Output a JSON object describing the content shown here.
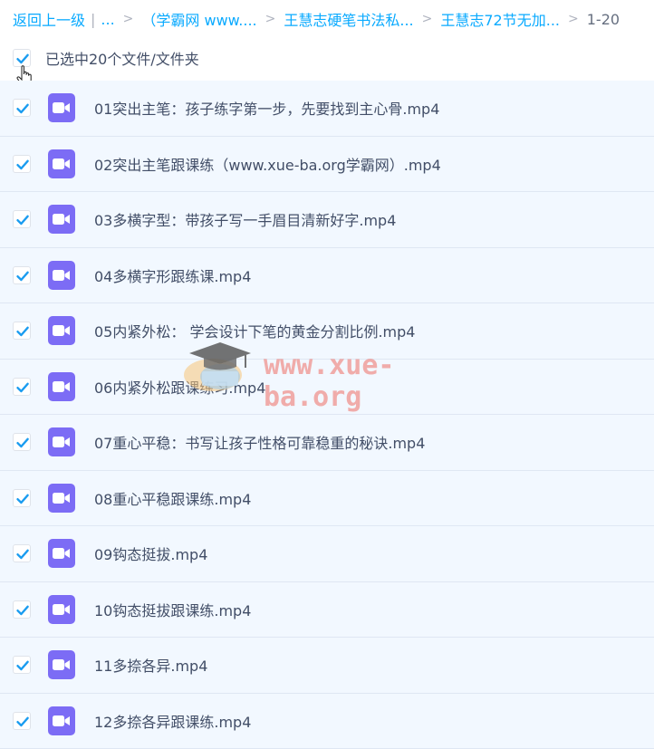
{
  "breadcrumb": {
    "back": "返回上一级",
    "sep_bar": "|",
    "ellipsis": "...",
    "chevron": ">",
    "crumb1": "（学霸网 www....",
    "crumb2": "王慧志硬笔书法私...",
    "crumb3": "王慧志72节无加...",
    "current": "1-20"
  },
  "selection": {
    "label": "已选中20个文件/文件夹",
    "checked": true
  },
  "files": [
    {
      "name": "01突出主笔：孩子练字第一步，先要找到主心骨.mp4",
      "checked": true
    },
    {
      "name": "02突出主笔跟课练（www.xue-ba.org学霸网）.mp4",
      "checked": true
    },
    {
      "name": "03多横字型：带孩子写一手眉目清新好字.mp4",
      "checked": true
    },
    {
      "name": "04多横字形跟练课.mp4",
      "checked": true
    },
    {
      "name": "05内紧外松： 学会设计下笔的黄金分割比例.mp4",
      "checked": true
    },
    {
      "name": "06内紧外松跟课练习.mp4",
      "checked": true
    },
    {
      "name": "07重心平稳：书写让孩子性格可靠稳重的秘诀.mp4",
      "checked": true
    },
    {
      "name": "08重心平稳跟课练.mp4",
      "checked": true
    },
    {
      "name": "09钩态挺拔.mp4",
      "checked": true
    },
    {
      "name": "10钩态挺拔跟课练.mp4",
      "checked": true
    },
    {
      "name": "11多捺各异.mp4",
      "checked": true
    },
    {
      "name": "12多捺各异跟课练.mp4",
      "checked": true
    }
  ],
  "watermark": {
    "text": "www.xue-ba.org"
  },
  "colors": {
    "accent": "#09aaff",
    "check": "#1a9cf0",
    "video_icon": "#7c6cf5",
    "row_bg": "#f2f8ff"
  },
  "icons": {
    "file": "video-file-icon",
    "check": "checkmark-icon",
    "cursor": "hand-pointer-icon"
  }
}
